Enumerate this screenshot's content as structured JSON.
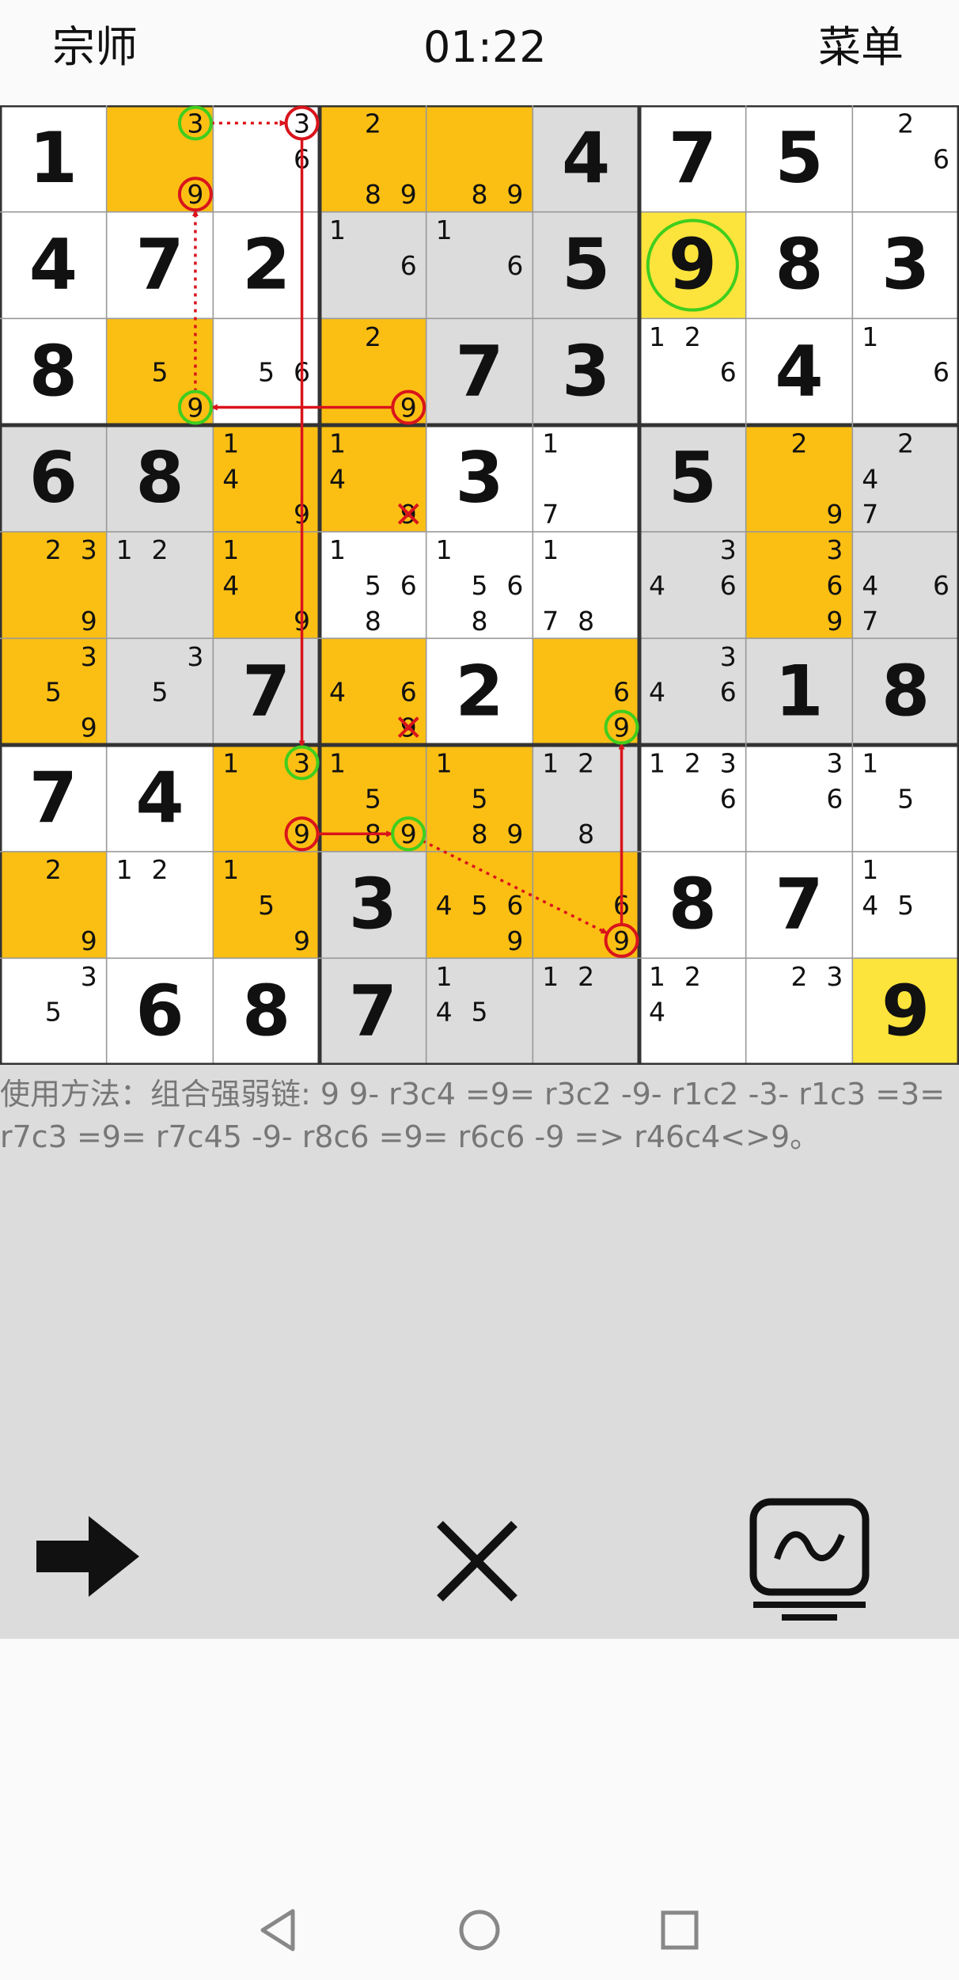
{
  "header": {
    "level": "宗师",
    "timer": "01:22",
    "menu": "菜单"
  },
  "board": {
    "cells": [
      [
        {
          "v": "1"
        },
        {
          "c": [
            3,
            9
          ],
          "bg": "o"
        },
        {
          "c": [
            3,
            6
          ]
        },
        {
          "c": [
            2,
            8,
            9
          ],
          "bg": "o"
        },
        {
          "c": [
            8,
            9
          ],
          "bg": "o"
        },
        {
          "v": "4",
          "bg": "g"
        },
        {
          "v": "7"
        },
        {
          "v": "5"
        },
        {
          "c": [
            2,
            6
          ]
        }
      ],
      [
        {
          "v": "4"
        },
        {
          "v": "7"
        },
        {
          "v": "2"
        },
        {
          "c": [
            1,
            6
          ],
          "bg": "g"
        },
        {
          "c": [
            1,
            6
          ],
          "bg": "g"
        },
        {
          "v": "5",
          "bg": "g"
        },
        {
          "v": "9",
          "bg": "y",
          "circle": true
        },
        {
          "v": "8"
        },
        {
          "v": "3"
        }
      ],
      [
        {
          "v": "8"
        },
        {
          "c": [
            5,
            9
          ],
          "bg": "o"
        },
        {
          "c": [
            5,
            6
          ]
        },
        {
          "c": [
            2,
            9
          ],
          "bg": "o"
        },
        {
          "v": "7",
          "bg": "g"
        },
        {
          "v": "3",
          "bg": "g"
        },
        {
          "c": [
            1,
            2,
            6
          ]
        },
        {
          "v": "4"
        },
        {
          "c": [
            1,
            6
          ]
        }
      ],
      [
        {
          "v": "6",
          "bg": "g"
        },
        {
          "v": "8",
          "bg": "g"
        },
        {
          "c": [
            1,
            4,
            9
          ],
          "bg": "o"
        },
        {
          "c": [
            1,
            4,
            9
          ],
          "bg": "o"
        },
        {
          "v": "3"
        },
        {
          "c": [
            1,
            7
          ]
        },
        {
          "v": "5",
          "bg": "g"
        },
        {
          "c": [
            2,
            9
          ],
          "bg": "o"
        },
        {
          "c": [
            2,
            4,
            7
          ],
          "bg": "g"
        }
      ],
      [
        {
          "c": [
            2,
            3,
            9
          ],
          "bg": "o"
        },
        {
          "c": [
            1,
            2
          ],
          "bg": "g"
        },
        {
          "c": [
            1,
            4,
            9
          ],
          "bg": "o"
        },
        {
          "c": [
            1,
            5,
            6,
            8
          ]
        },
        {
          "c": [
            1,
            5,
            6,
            8
          ]
        },
        {
          "c": [
            1,
            7,
            8
          ]
        },
        {
          "c": [
            3,
            4,
            6
          ],
          "bg": "g"
        },
        {
          "c": [
            3,
            6,
            9
          ],
          "bg": "o"
        },
        {
          "c": [
            4,
            6,
            7
          ],
          "bg": "g"
        }
      ],
      [
        {
          "c": [
            3,
            5,
            9
          ],
          "bg": "o"
        },
        {
          "c": [
            3,
            5
          ],
          "bg": "g"
        },
        {
          "v": "7",
          "bg": "g"
        },
        {
          "c": [
            4,
            6,
            9
          ],
          "bg": "o"
        },
        {
          "v": "2"
        },
        {
          "c": [
            6,
            9
          ],
          "bg": "o"
        },
        {
          "c": [
            3,
            4,
            6
          ],
          "bg": "g"
        },
        {
          "v": "1",
          "bg": "g"
        },
        {
          "v": "8",
          "bg": "g"
        }
      ],
      [
        {
          "v": "7"
        },
        {
          "v": "4"
        },
        {
          "c": [
            1,
            3,
            9
          ],
          "bg": "o"
        },
        {
          "c": [
            1,
            5,
            8,
            9
          ],
          "bg": "o"
        },
        {
          "c": [
            1,
            5,
            8,
            9
          ],
          "bg": "o"
        },
        {
          "c": [
            1,
            2,
            8
          ],
          "bg": "g"
        },
        {
          "c": [
            1,
            2,
            3,
            6
          ]
        },
        {
          "c": [
            3,
            6
          ]
        },
        {
          "c": [
            1,
            5
          ]
        }
      ],
      [
        {
          "c": [
            2,
            9
          ],
          "bg": "o"
        },
        {
          "c": [
            1,
            2
          ]
        },
        {
          "c": [
            1,
            5,
            9
          ],
          "bg": "o"
        },
        {
          "v": "3",
          "bg": "g"
        },
        {
          "c": [
            4,
            5,
            6,
            9
          ],
          "bg": "o"
        },
        {
          "c": [
            6,
            9
          ],
          "bg": "o"
        },
        {
          "v": "8"
        },
        {
          "v": "7"
        },
        {
          "c": [
            1,
            4,
            5
          ]
        }
      ],
      [
        {
          "c": [
            3,
            5
          ]
        },
        {
          "v": "6"
        },
        {
          "v": "8"
        },
        {
          "v": "7",
          "bg": "g"
        },
        {
          "c": [
            1,
            4,
            5
          ],
          "bg": "g"
        },
        {
          "c": [
            1,
            2
          ],
          "bg": "g"
        },
        {
          "c": [
            1,
            2,
            4
          ]
        },
        {
          "c": [
            2,
            3
          ]
        },
        {
          "v": "9",
          "bg": "y"
        }
      ]
    ],
    "marks": [
      {
        "r": 0,
        "c": 1,
        "d": 3,
        "ring": "green"
      },
      {
        "r": 0,
        "c": 1,
        "d": 9,
        "ring": "red"
      },
      {
        "r": 0,
        "c": 2,
        "d": 3,
        "ring": "red"
      },
      {
        "r": 2,
        "c": 1,
        "d": 9,
        "ring": "green"
      },
      {
        "r": 2,
        "c": 3,
        "d": 9,
        "ring": "red"
      },
      {
        "r": 5,
        "c": 5,
        "d": 9,
        "ring": "green"
      },
      {
        "r": 6,
        "c": 2,
        "d": 3,
        "ring": "green"
      },
      {
        "r": 6,
        "c": 2,
        "d": 9,
        "ring": "red"
      },
      {
        "r": 6,
        "c": 3,
        "d": 9,
        "ring": "green"
      },
      {
        "r": 7,
        "c": 5,
        "d": 9,
        "ring": "red"
      },
      {
        "r": 3,
        "c": 3,
        "d": 9,
        "ring": "cross"
      },
      {
        "r": 5,
        "c": 3,
        "d": 9,
        "ring": "cross"
      }
    ],
    "links": [
      {
        "from": [
          0,
          1,
          3
        ],
        "to": [
          0,
          2,
          3
        ],
        "style": "dotted"
      },
      {
        "from": [
          2,
          1,
          9
        ],
        "to": [
          0,
          1,
          9
        ],
        "style": "dotted"
      },
      {
        "from": [
          2,
          3,
          9
        ],
        "to": [
          2,
          1,
          9
        ],
        "style": "solid"
      },
      {
        "from": [
          0,
          2,
          3
        ],
        "to": [
          6,
          2,
          3
        ],
        "style": "solid"
      },
      {
        "from": [
          6,
          2,
          9
        ],
        "to": [
          6,
          3,
          9
        ],
        "style": "solid"
      },
      {
        "from": [
          6,
          3,
          9
        ],
        "to": [
          7,
          5,
          9
        ],
        "style": "dotted"
      },
      {
        "from": [
          7,
          5,
          9
        ],
        "to": [
          5,
          5,
          9
        ],
        "style": "solid"
      }
    ]
  },
  "hint": {
    "text": "使用方法：组合强弱链: 9 9- r3c4 =9= r3c2 -9- r1c2 -3- r1c3 =3= r7c3 =9= r7c45 -9- r8c6 =9= r6c6 -9 => r46c4<>9。"
  },
  "toolbar": {
    "next_icon": "arrow-right-icon",
    "close_icon": "close-icon",
    "chart_icon": "monitor-wave-icon"
  },
  "nav": {
    "back_icon": "back-triangle-icon",
    "home_icon": "home-circle-icon",
    "recents_icon": "recents-square-icon"
  },
  "colors": {
    "orange": "#fbbf14",
    "grey": "#dcdcdc",
    "yellow": "#fde43c",
    "red": "#d9141b",
    "green": "#3fce1e"
  }
}
